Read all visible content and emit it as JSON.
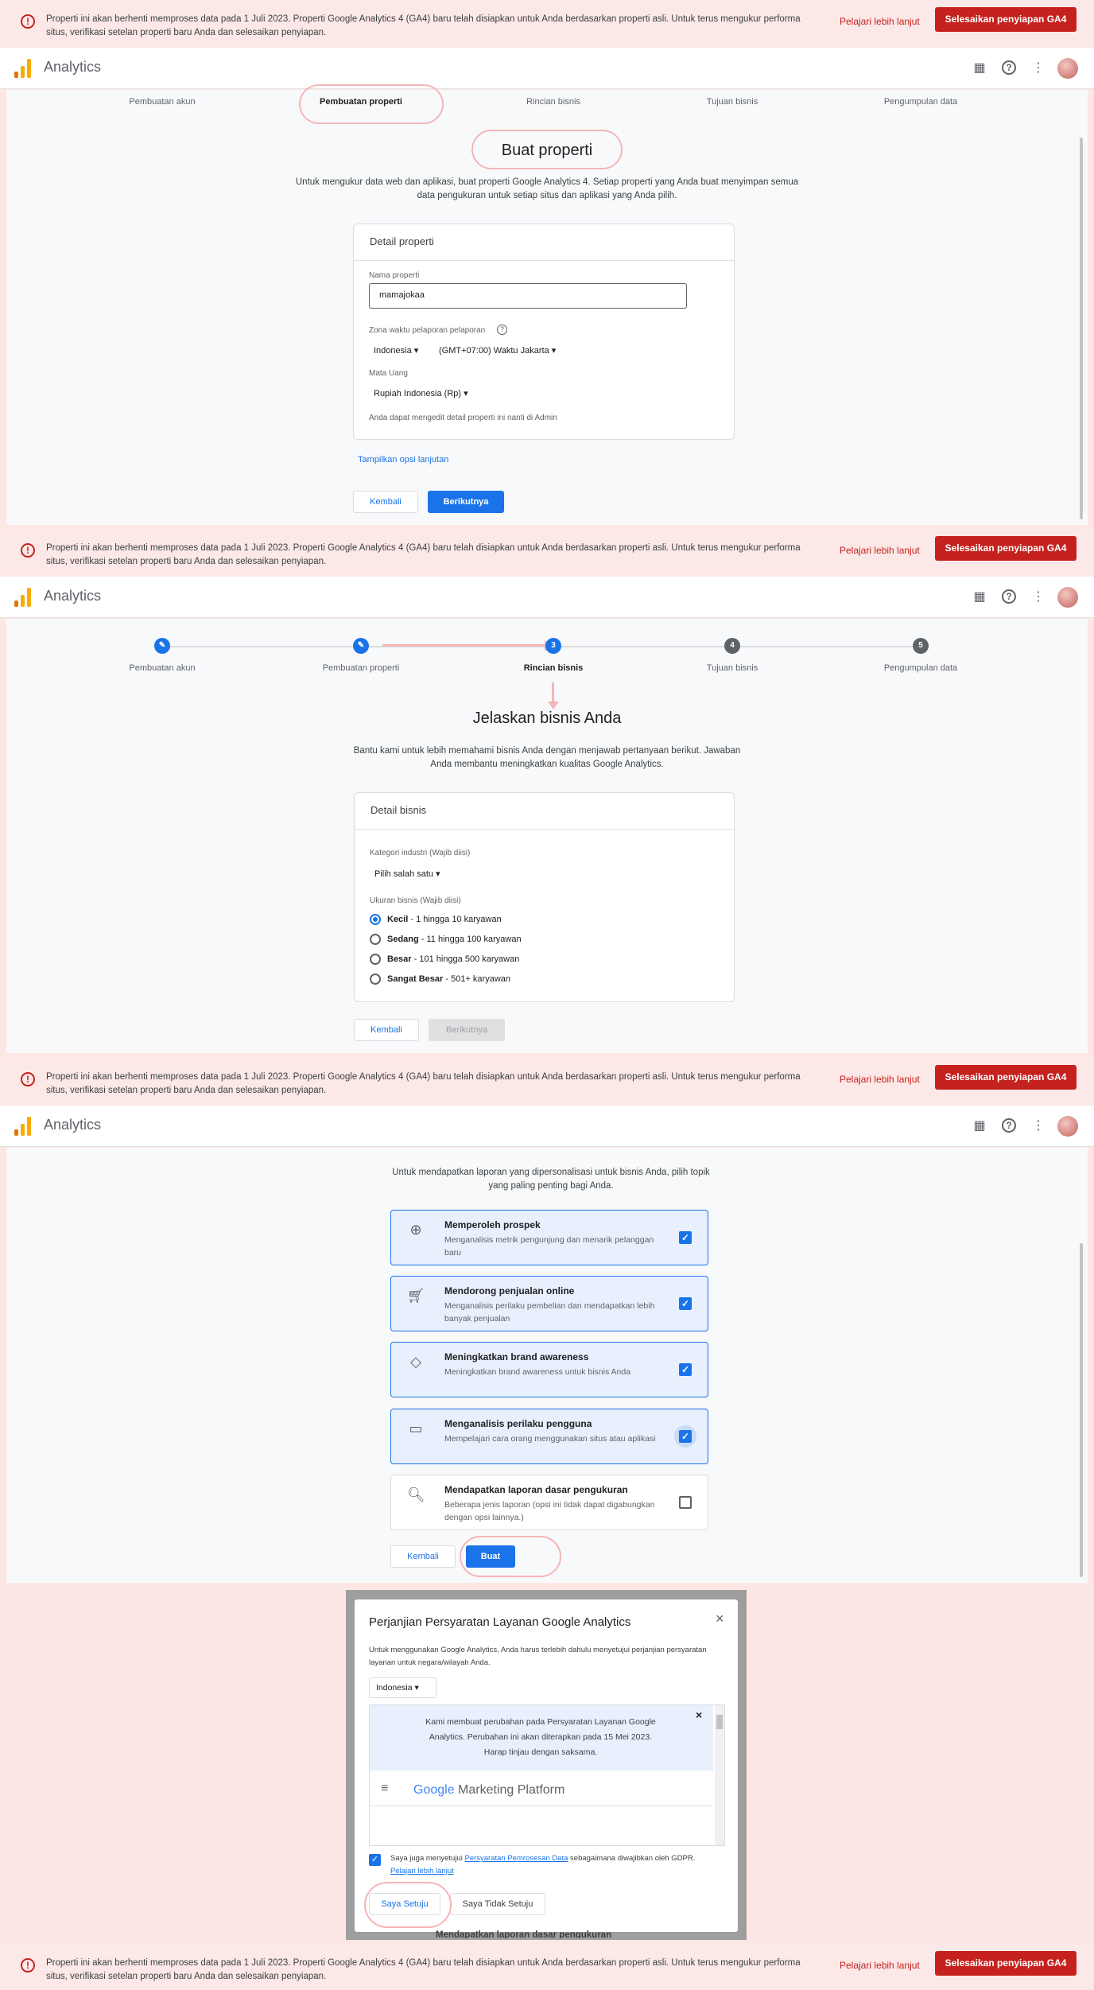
{
  "banner": {
    "message": "Properti ini akan berhenti memproses data pada 1 Juli 2023. Properti Google Analytics 4 (GA4) baru telah disiapkan untuk Anda berdasarkan properti asli. Untuk terus mengukur performa situs, verifikasi setelan properti baru Anda dan selesaikan penyiapan.",
    "learn_more": "Pelajari lebih lanjut",
    "action": "Selesaikan penyiapan GA4"
  },
  "appbar": {
    "title": "Analytics",
    "icons": [
      "apps-icon",
      "help-icon",
      "more-vert-icon",
      "avatar"
    ]
  },
  "steps": [
    "Pembuatan akun",
    "Pembuatan properti",
    "Rincian bisnis",
    "Tujuan bisnis",
    "Pengumpulan data"
  ],
  "step_numbers": [
    "3",
    "4",
    "5"
  ],
  "screen1": {
    "heading": "Buat properti",
    "intro": "Untuk mengukur data web dan aplikasi, buat properti Google Analytics 4. Setiap properti yang Anda buat menyimpan semua data pengukuran untuk setiap situs dan aplikasi yang Anda pilih.",
    "card_title": "Detail properti",
    "name_label": "Nama properti",
    "name_value": "mamajokaa",
    "tz_label": "Zona waktu pelaporan pelaporan",
    "tz_country": "Indonesia",
    "tz_value": "(GMT+07:00) Waktu Jakarta",
    "currency_label": "Mata Uang",
    "currency_value": "Rupiah Indonesia (Rp)",
    "note": "Anda dapat mengedit detail properti ini nanti di Admin",
    "advanced": "Tampilkan opsi lanjutan",
    "back": "Kembali",
    "next": "Berikutnya"
  },
  "screen2": {
    "heading": "Jelaskan bisnis Anda",
    "intro": "Bantu kami untuk lebih memahami bisnis Anda dengan menjawab pertanyaan berikut. Jawaban Anda membantu meningkatkan kualitas Google Analytics.",
    "card_title": "Detail bisnis",
    "industry_label": "Kategori industri (Wajib diisi)",
    "industry_value": "Pilih salah satu",
    "size_label": "Ukuran bisnis (Wajib diisi)",
    "sizes": [
      {
        "name": "Kecil",
        "desc": " - 1 hingga 10 karyawan",
        "selected": true
      },
      {
        "name": "Sedang",
        "desc": " - 11 hingga 100 karyawan",
        "selected": false
      },
      {
        "name": "Besar",
        "desc": " - 101 hingga 500 karyawan",
        "selected": false
      },
      {
        "name": "Sangat Besar",
        "desc": " - 501+ karyawan",
        "selected": false
      }
    ],
    "back": "Kembali",
    "next": "Berikutnya"
  },
  "screen3": {
    "intro": "Untuk mendapatkan laporan yang dipersonalisasi untuk bisnis Anda, pilih topik yang paling penting bagi Anda.",
    "options": [
      {
        "title": "Memperoleh prospek",
        "desc": "Menganalisis metrik pengunjung dan menarik pelanggan baru",
        "checked": true,
        "icon": "target-icon"
      },
      {
        "title": "Mendorong penjualan online",
        "desc": "Menganalisis perilaku pembelian dan mendapatkan lebih banyak penjualan",
        "checked": true,
        "icon": "cart-icon"
      },
      {
        "title": "Meningkatkan brand awareness",
        "desc": "Meningkatkan brand awareness untuk bisnis Anda",
        "checked": true,
        "icon": "tag-icon"
      },
      {
        "title": "Menganalisis perilaku pengguna",
        "desc": "Mempelajari cara orang menggunakan situs atau aplikasi",
        "checked": true,
        "icon": "screen-cursor-icon"
      },
      {
        "title": "Mendapatkan laporan dasar pengukuran",
        "desc": "Beberapa jenis laporan (opsi ini tidak dapat digabungkan dengan opsi lainnya.)",
        "checked": false,
        "icon": "report-search-icon"
      }
    ],
    "back": "Kembali",
    "create": "Buat"
  },
  "dialog": {
    "title": "Perjanjian Persyaratan Layanan Google Analytics",
    "intro": "Untuk menggunakan Google Analytics, Anda harus terlebih dahulu menyetujui perjanjian persyaratan layanan untuk negara/wilayah Anda.",
    "country": "Indonesia",
    "notice": "Kami membuat perubahan pada Persyaratan Layanan Google Analytics. Perubahan ini akan diterapkan pada 15 Mei 2023. Harap tinjau dengan saksama.",
    "platform_google": "Google",
    "platform_name": "Marketing Platform",
    "gdpr_prefix": "Saya juga menyetujui ",
    "gdpr_link": "Persyaratan Pemrosesan Data",
    "gdpr_suffix": " sebagaimana diwajibkan oleh GDPR.",
    "learn_more": "Pelajari lebih lanjut",
    "agree": "Saya Setuju",
    "disagree": "Saya Tidak Setuju",
    "behind_text": "Mendapatkan laporan dasar pengukuran"
  },
  "colors": {
    "accent": "#1a73e8",
    "danger": "#c5221f",
    "annotation": "#f4b6b8",
    "banner_bg": "#fce8e6"
  }
}
